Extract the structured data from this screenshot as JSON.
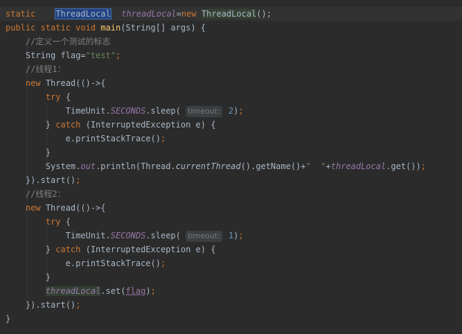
{
  "editor": {
    "lines": [
      {
        "current": true,
        "tokens": [
          [
            "kw",
            "static    "
          ],
          [
            "sel",
            "ThreadLocal"
          ],
          [
            "caret",
            ""
          ],
          [
            "",
            "  "
          ],
          [
            "fld",
            "threadLocal"
          ],
          [
            "",
            "="
          ],
          [
            "kw",
            "new "
          ],
          [
            "hl",
            "ThreadLocal"
          ],
          [
            "",
            "();"
          ]
        ]
      },
      {
        "tokens": [
          [
            "kw",
            "public static void "
          ],
          [
            "fn",
            "main"
          ],
          [
            "",
            "(String[] args) {"
          ]
        ]
      },
      {
        "tokens": [
          [
            "",
            "    "
          ],
          [
            "cmt",
            "//定义一个测试的标志"
          ]
        ]
      },
      {
        "tokens": [
          [
            "",
            "    String flag="
          ],
          [
            "str",
            "\"test\""
          ],
          [
            "kw",
            ";"
          ]
        ]
      },
      {
        "tokens": [
          [
            "",
            "    "
          ],
          [
            "cmt",
            "//线程1："
          ]
        ]
      },
      {
        "tokens": [
          [
            "",
            "    "
          ],
          [
            "kw",
            "new "
          ],
          [
            "",
            "Thread(()->{"
          ]
        ]
      },
      {
        "tokens": [
          [
            "",
            "        "
          ],
          [
            "kw",
            "try "
          ],
          [
            "",
            "{"
          ]
        ]
      },
      {
        "tokens": [
          [
            "",
            "            TimeUnit."
          ],
          [
            "fld",
            "SECONDS"
          ],
          [
            "",
            ".sleep( "
          ],
          [
            "hint",
            "timeout:"
          ],
          [
            "num",
            " 2"
          ],
          [
            "",
            ")"
          ],
          [
            "kw",
            ";"
          ]
        ]
      },
      {
        "tokens": [
          [
            "",
            "        } "
          ],
          [
            "kw",
            "catch "
          ],
          [
            "",
            "(InterruptedException e) {"
          ]
        ]
      },
      {
        "tokens": [
          [
            "",
            "            e.printStackTrace()"
          ],
          [
            "kw",
            ";"
          ]
        ]
      },
      {
        "tokens": [
          [
            "",
            "        }"
          ]
        ]
      },
      {
        "tokens": [
          [
            "",
            "        System."
          ],
          [
            "fld",
            "out"
          ],
          [
            "",
            ".println(Thread."
          ],
          [
            "ital",
            "currentThread"
          ],
          [
            "",
            "().getName()+"
          ],
          [
            "str",
            "\"  \""
          ],
          [
            "",
            "+"
          ],
          [
            "fld",
            "threadLocal"
          ],
          [
            "",
            ".get())"
          ],
          [
            "kw",
            ";"
          ]
        ]
      },
      {
        "tokens": [
          [
            "",
            "    }).start()"
          ],
          [
            "kw",
            ";"
          ]
        ]
      },
      {
        "tokens": [
          [
            "",
            "    "
          ],
          [
            "cmt",
            "//线程2："
          ]
        ]
      },
      {
        "tokens": [
          [
            "",
            "    "
          ],
          [
            "kw",
            "new "
          ],
          [
            "",
            "Thread(()->{"
          ]
        ]
      },
      {
        "tokens": [
          [
            "",
            "        "
          ],
          [
            "kw",
            "try "
          ],
          [
            "",
            "{"
          ]
        ]
      },
      {
        "tokens": [
          [
            "",
            "            TimeUnit."
          ],
          [
            "fld",
            "SECONDS"
          ],
          [
            "",
            ".sleep( "
          ],
          [
            "hint",
            "timeout:"
          ],
          [
            "num",
            " 1"
          ],
          [
            "",
            ")"
          ],
          [
            "kw",
            ";"
          ]
        ]
      },
      {
        "tokens": [
          [
            "",
            "        } "
          ],
          [
            "kw",
            "catch "
          ],
          [
            "",
            "(InterruptedException e) {"
          ]
        ]
      },
      {
        "tokens": [
          [
            "",
            "            e.printStackTrace()"
          ],
          [
            "kw",
            ";"
          ]
        ]
      },
      {
        "tokens": [
          [
            "",
            "        }"
          ]
        ]
      },
      {
        "tokens": [
          [
            "",
            "        "
          ],
          [
            "fldhl",
            "threadLocal"
          ],
          [
            "",
            ".set("
          ],
          [
            "ulp",
            "flag"
          ],
          [
            "",
            ")"
          ],
          [
            "kw",
            ";"
          ]
        ]
      },
      {
        "tokens": [
          [
            "",
            "    }).start()"
          ],
          [
            "kw",
            ";"
          ]
        ]
      },
      {
        "tokens": [
          [
            "",
            "}"
          ]
        ]
      }
    ]
  }
}
